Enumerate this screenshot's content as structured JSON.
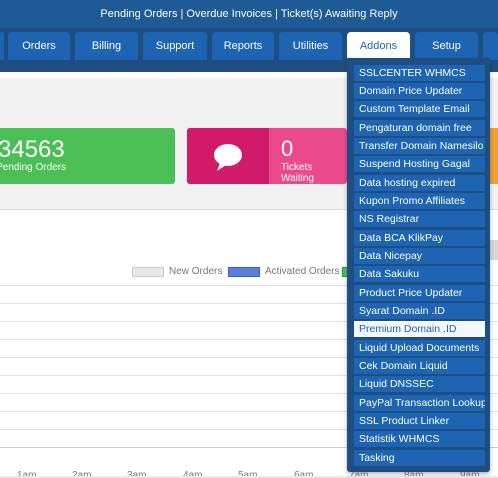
{
  "topbar": {
    "text": "Pending Orders | Overdue Invoices | Ticket(s) Awaiting Reply"
  },
  "nav": {
    "tabs": [
      {
        "label": "Orders"
      },
      {
        "label": "Billing"
      },
      {
        "label": "Support"
      },
      {
        "label": "Reports"
      },
      {
        "label": "Utilities"
      },
      {
        "label": "Addons"
      },
      {
        "label": "Setup"
      }
    ]
  },
  "cards": {
    "pending": {
      "value": "34563",
      "label": "Pending Orders"
    },
    "tickets": {
      "value": "0",
      "label": "Tickets Waiting"
    }
  },
  "legend": {
    "items": [
      {
        "label": "New Orders",
        "color": "#e0e0e0"
      },
      {
        "label": "Activated Orders",
        "color": "#5b7fe0"
      },
      {
        "label": "",
        "color": "#4bbf55"
      }
    ]
  },
  "chart_data": {
    "type": "line",
    "x": [
      "1am",
      "2am",
      "3am",
      "4am",
      "5am",
      "6am",
      "7am",
      "8am",
      "9am"
    ],
    "series": [
      {
        "name": "New Orders",
        "values": []
      },
      {
        "name": "Activated Orders",
        "values": []
      }
    ],
    "grid": true,
    "legend": "top-right"
  },
  "addons_menu": {
    "items": [
      "SSLCENTER WHMCS",
      "Domain Price Updater",
      "Custom Template Email",
      "Pengaturan domain free",
      "Transfer Domain Namesilo",
      "Suspend Hosting Gagal",
      "Data hosting expired",
      "Kupon Promo Affiliates",
      "NS Registrar",
      "Data BCA KlikPay",
      "Data Nicepay",
      "Data Sakuku",
      "Product Price Updater",
      "Syarat Domain .ID",
      "Premium Domain .ID",
      "Liquid Upload Documents",
      "Cek Domain Liquid",
      "Liquid DNSSEC",
      "PayPal Transaction Lookup",
      "SSL Product Linker",
      "Statistik WHMCS",
      "Tasking"
    ],
    "highlighted": "Premium Domain .ID"
  },
  "colors": {
    "nav_bg": "#1f4f82",
    "tab_bg": "#1d64b2",
    "green": "#4bbf55",
    "pink": "#ea4a8c"
  }
}
